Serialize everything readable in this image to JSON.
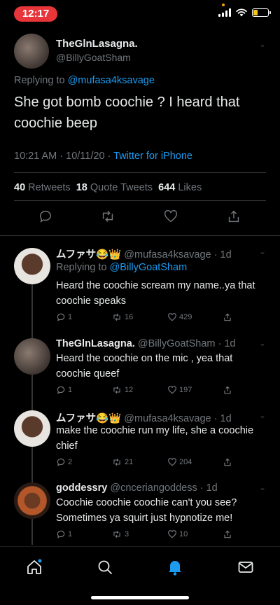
{
  "status_bar": {
    "time": "12:17"
  },
  "main_tweet": {
    "display_name": "TheGlnLasagna.",
    "handle": "@BillyGoatSham",
    "replying_prefix": "Replying to",
    "replying_to": "@mufasa4ksavage",
    "text": "She got bomb coochie ? I heard that coochie beep",
    "timestamp": "10:21 AM · 10/11/20 ·",
    "source": "Twitter for iPhone",
    "stats": {
      "retweets": "40",
      "retweets_label": "Retweets",
      "quotes": "18",
      "quotes_label": "Quote Tweets",
      "likes": "644",
      "likes_label": "Likes"
    }
  },
  "replies": [
    {
      "display_name": "ムファサ😂👑",
      "handle": "@mufasa4ksavage · 1d",
      "replying_prefix": "Replying to",
      "replying_to": "@BillyGoatSham",
      "text": "Heard the coochie scream my name..ya that coochie speaks",
      "replies": "1",
      "retweets": "16",
      "likes": "429"
    },
    {
      "display_name": "TheGlnLasagna.",
      "handle": "@BillyGoatSham · 1d",
      "text": "Heard the coochie on the mic , yea that coochie queef",
      "replies": "1",
      "retweets": "12",
      "likes": "197"
    },
    {
      "display_name": "ムファサ😂👑",
      "handle": "@mufasa4ksavage · 1d",
      "text": "make the coochie run my life, she a coochie chief",
      "replies": "2",
      "retweets": "21",
      "likes": "204"
    },
    {
      "display_name": "goddessry",
      "handle": "@cnceriangoddess · 1d",
      "text": "Coochie coochie coochie can't you see? Sometimes ya squirt just hypnotize me!",
      "replies": "1",
      "retweets": "3",
      "likes": "10"
    }
  ],
  "tab_bar": [
    "home-icon",
    "search-icon",
    "notifications-icon",
    "messages-icon"
  ],
  "colors": {
    "accent": "#1d9bf0",
    "background": "#000000",
    "muted": "#71767b",
    "time_pill": "#e8353a"
  }
}
